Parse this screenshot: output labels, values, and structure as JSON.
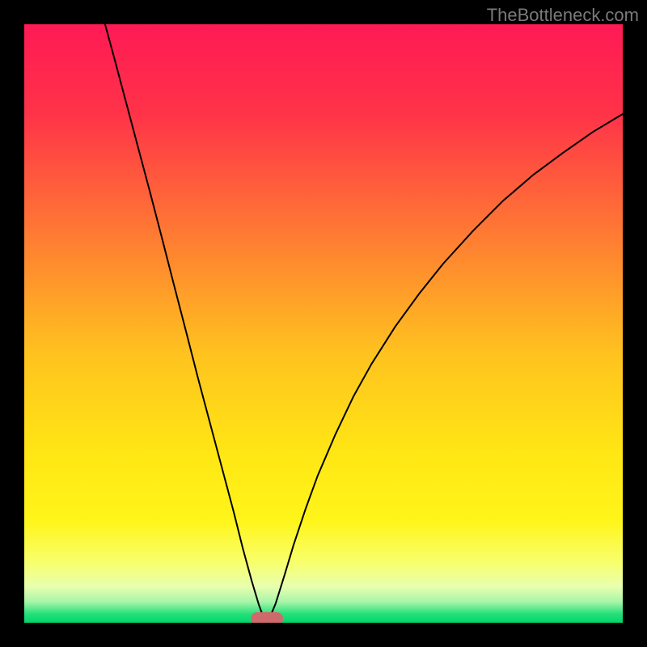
{
  "watermark": "TheBottleneck.com",
  "colors": {
    "frame": "#000000",
    "gradient_stops": [
      {
        "offset": 0.0,
        "color": "#ff1a55"
      },
      {
        "offset": 0.15,
        "color": "#ff3348"
      },
      {
        "offset": 0.35,
        "color": "#ff7a33"
      },
      {
        "offset": 0.55,
        "color": "#ffc21f"
      },
      {
        "offset": 0.72,
        "color": "#ffe714"
      },
      {
        "offset": 0.83,
        "color": "#fff51a"
      },
      {
        "offset": 0.9,
        "color": "#f8ff6e"
      },
      {
        "offset": 0.94,
        "color": "#e8ffb0"
      },
      {
        "offset": 0.965,
        "color": "#a8f5a8"
      },
      {
        "offset": 0.985,
        "color": "#27e07a"
      },
      {
        "offset": 1.0,
        "color": "#00d66a"
      }
    ],
    "curve": "#000000",
    "marker": "#cf6a6c"
  },
  "chart_data": {
    "type": "line",
    "title": "",
    "xlabel": "",
    "ylabel": "",
    "xlim": [
      0,
      100
    ],
    "ylim": [
      0,
      100
    ],
    "minimum": {
      "x": 40.5,
      "y": 0
    },
    "curve_points": [
      {
        "x": 13.5,
        "y": 100.0
      },
      {
        "x": 15.0,
        "y": 94.5
      },
      {
        "x": 17.0,
        "y": 87.0
      },
      {
        "x": 19.0,
        "y": 79.5
      },
      {
        "x": 21.0,
        "y": 72.0
      },
      {
        "x": 23.0,
        "y": 64.3
      },
      {
        "x": 25.0,
        "y": 56.5
      },
      {
        "x": 27.0,
        "y": 48.8
      },
      {
        "x": 29.0,
        "y": 41.0
      },
      {
        "x": 31.0,
        "y": 33.5
      },
      {
        "x": 33.0,
        "y": 26.0
      },
      {
        "x": 35.0,
        "y": 18.5
      },
      {
        "x": 36.5,
        "y": 12.5
      },
      {
        "x": 38.0,
        "y": 7.0
      },
      {
        "x": 39.2,
        "y": 3.0
      },
      {
        "x": 40.0,
        "y": 0.8
      },
      {
        "x": 40.5,
        "y": 0.0
      },
      {
        "x": 41.0,
        "y": 0.8
      },
      {
        "x": 42.0,
        "y": 3.2
      },
      {
        "x": 43.5,
        "y": 8.0
      },
      {
        "x": 45.0,
        "y": 13.0
      },
      {
        "x": 47.0,
        "y": 19.0
      },
      {
        "x": 49.0,
        "y": 24.5
      },
      {
        "x": 52.0,
        "y": 31.5
      },
      {
        "x": 55.0,
        "y": 37.8
      },
      {
        "x": 58.0,
        "y": 43.2
      },
      {
        "x": 62.0,
        "y": 49.5
      },
      {
        "x": 66.0,
        "y": 55.0
      },
      {
        "x": 70.0,
        "y": 60.0
      },
      {
        "x": 75.0,
        "y": 65.5
      },
      {
        "x": 80.0,
        "y": 70.5
      },
      {
        "x": 85.0,
        "y": 74.8
      },
      {
        "x": 90.0,
        "y": 78.5
      },
      {
        "x": 95.0,
        "y": 82.0
      },
      {
        "x": 100.0,
        "y": 85.0
      }
    ]
  }
}
